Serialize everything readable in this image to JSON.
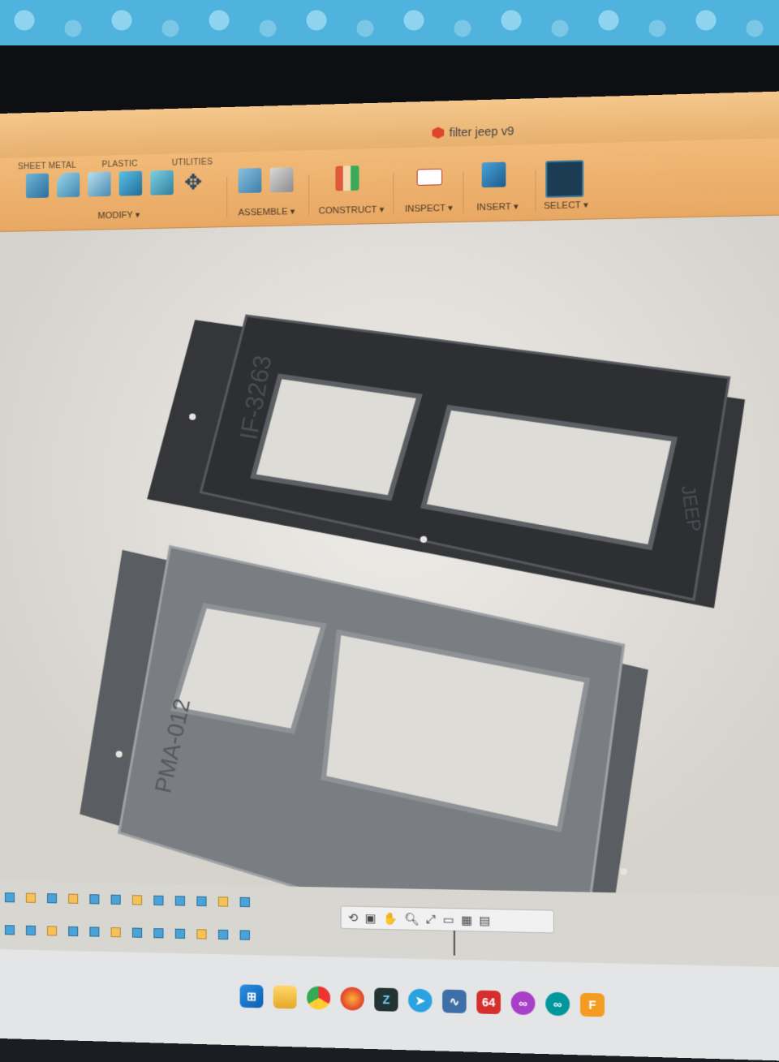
{
  "window": {
    "title": "filter jeep v9"
  },
  "toolbar": {
    "tabs": [
      "SHEET METAL",
      "PLASTIC",
      "UTILITIES"
    ],
    "groups": {
      "modify": "MODIFY ▾",
      "assemble": "ASSEMBLE ▾",
      "construct": "CONSTRUCT ▾",
      "inspect": "INSPECT ▾",
      "insert": "INSERT ▾",
      "select": "SELECT ▾"
    }
  },
  "model": {
    "part_top_text": "IF-3263",
    "part_top_brand": "JEEP",
    "part_bottom_text": "PMA-012"
  },
  "taskbar": {
    "badge_64": "64",
    "fusion_label": "F"
  },
  "icons": [
    "fusion-doc-icon",
    "sheet-metal-icon",
    "fillet-icon",
    "shell-icon",
    "combine-icon",
    "draft-icon",
    "move-icon",
    "new-component-icon",
    "joint-icon",
    "offset-plane-icon",
    "measure-icon",
    "insert-image-icon",
    "select-icon",
    "windows-start-icon",
    "file-explorer-icon",
    "chrome-icon",
    "firefox-icon",
    "z-app-icon",
    "telegram-icon",
    "monitor-app-icon",
    "n64-emulator-icon",
    "cf-app-icon",
    "arduino-icon",
    "fusion360-icon"
  ],
  "colors": {
    "toolbar_orange": "#efb46f",
    "viewport_bg": "#e6e4df",
    "part_dark": "#3a3c40",
    "part_grey": "#6b6e72"
  }
}
